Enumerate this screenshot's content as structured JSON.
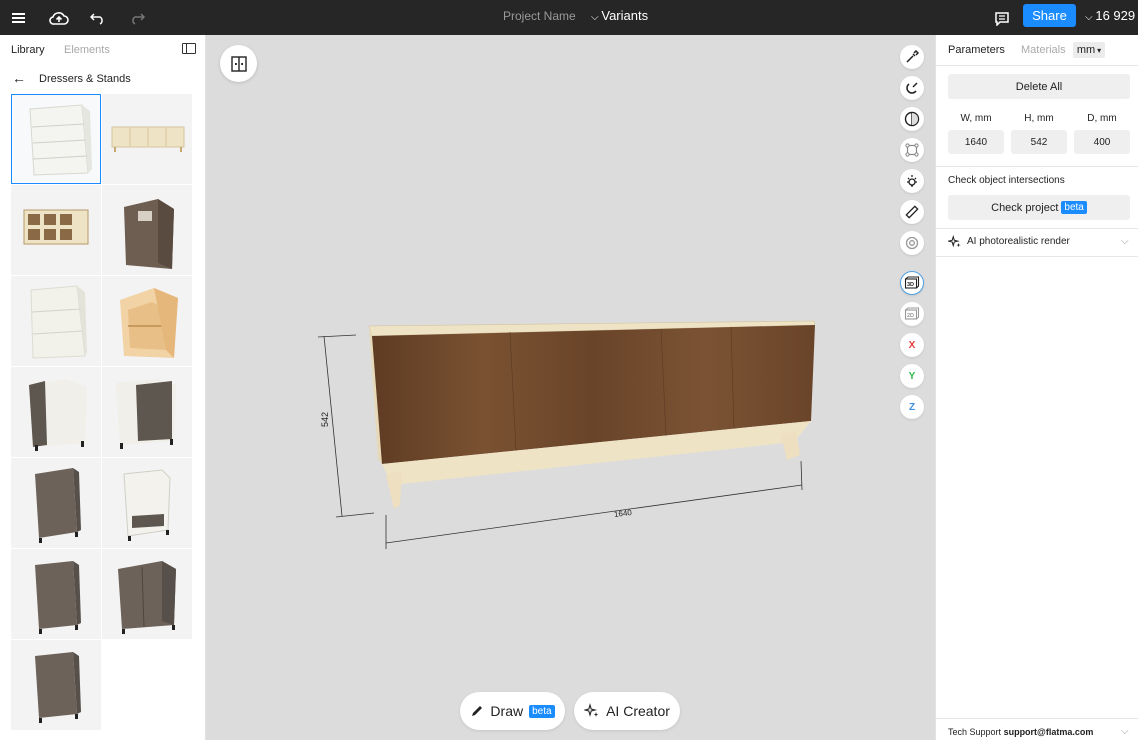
{
  "topbar": {
    "project_name": "Project Name",
    "variants": "Variants",
    "share": "Share",
    "count": "16 929",
    "icons": [
      "menu-icon",
      "cloud-upload-icon",
      "undo-icon",
      "redo-icon",
      "comment-icon",
      "chevron-down-icon"
    ]
  },
  "left": {
    "tabs": [
      "Library",
      "Elements"
    ],
    "back": "←",
    "category": "Dressers & Stands"
  },
  "viewport": {
    "dim_height": "542",
    "dim_width": "1640",
    "draw_label": "Draw",
    "draw_badge": "beta",
    "ai_label": "AI Creator",
    "tools": {
      "x": "X",
      "y": "Y",
      "z": "Z",
      "view3d": "3D"
    }
  },
  "right": {
    "tabs": [
      "Parameters",
      "Materials"
    ],
    "units": "mm",
    "delete_all": "Delete All",
    "w_label": "W, mm",
    "h_label": "H, mm",
    "d_label": "D, mm",
    "w": "1640",
    "h": "542",
    "d": "400",
    "intersections": "Check object intersections",
    "check_project": "Check project",
    "check_badge": "beta",
    "ai_render": "AI photorealistic render",
    "support_label": "Tech Support",
    "support_email": "support@flatma.com"
  },
  "colors": {
    "accent": "#1a8cff",
    "topbar": "#262626",
    "wood_dark": "#6b4528",
    "wood_light": "#efe3c6",
    "x_axis": "#e23b3b",
    "y_axis": "#2fb84a",
    "z_axis": "#3f8fe0"
  }
}
